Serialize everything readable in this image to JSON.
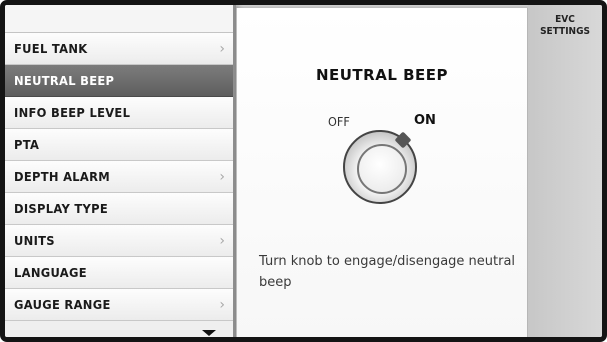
{
  "header": {
    "title_line1": "EVC",
    "title_line2": "SETTINGS"
  },
  "menu": {
    "items": [
      {
        "label": "FUEL TANK",
        "has_submenu": true,
        "selected": false
      },
      {
        "label": "NEUTRAL BEEP",
        "has_submenu": false,
        "selected": true
      },
      {
        "label": "INFO BEEP LEVEL",
        "has_submenu": false,
        "selected": false
      },
      {
        "label": "PTA",
        "has_submenu": false,
        "selected": false
      },
      {
        "label": "DEPTH ALARM",
        "has_submenu": true,
        "selected": false
      },
      {
        "label": "DISPLAY TYPE",
        "has_submenu": false,
        "selected": false
      },
      {
        "label": "UNITS",
        "has_submenu": true,
        "selected": false
      },
      {
        "label": "LANGUAGE",
        "has_submenu": false,
        "selected": false
      },
      {
        "label": "GAUGE RANGE",
        "has_submenu": true,
        "selected": false
      }
    ],
    "chevron": "›"
  },
  "panel": {
    "title": "NEUTRAL BEEP",
    "knob": {
      "off_label": "OFF",
      "on_label": "ON",
      "state": "ON"
    },
    "instruction": "Turn knob to engage/disengage neutral beep"
  },
  "icons": {
    "submenu": "chevron-right-icon",
    "scroll": "scroll-down-arrow-icon",
    "knob": "rotary-knob-icon"
  },
  "colors": {
    "selected_bg": "#6b6b6b",
    "panel_bg": "#ffffff",
    "background": "#d3d3d3"
  }
}
